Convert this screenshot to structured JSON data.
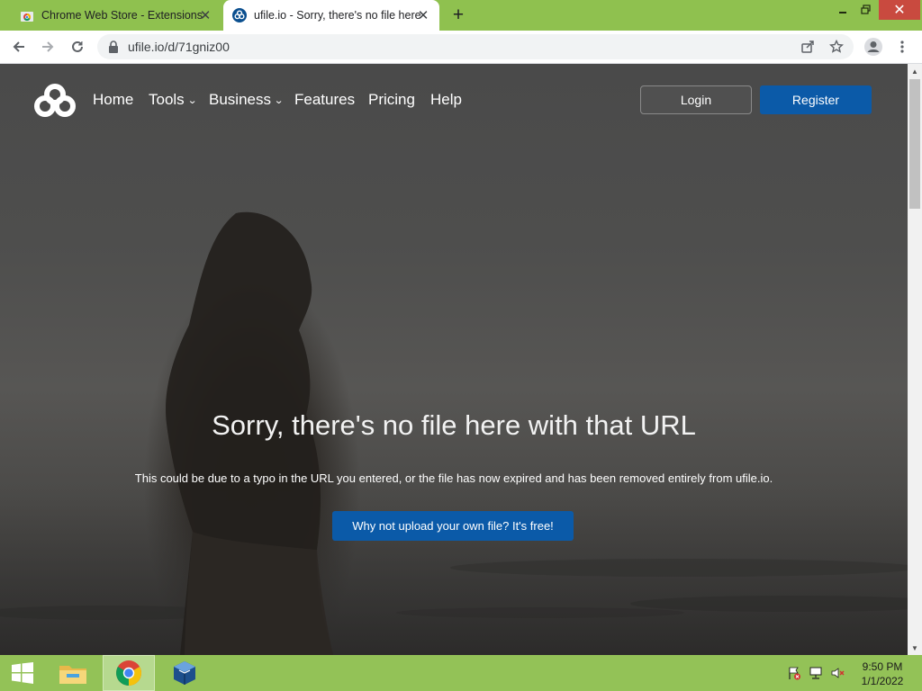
{
  "browser": {
    "tabs": [
      {
        "title": "Chrome Web Store - Extensions",
        "icon": "chrome-web-store-icon"
      },
      {
        "title": "ufile.io - Sorry, there's no file here",
        "icon": "ufile-icon",
        "active": true
      }
    ],
    "new_tab_label": "+",
    "url": "ufile.io/d/71gniz00"
  },
  "page": {
    "nav": {
      "items": [
        "Home",
        "Tools",
        "Business",
        "Features",
        "Pricing",
        "Help"
      ],
      "dropdowns": [
        "Tools",
        "Business"
      ],
      "login_label": "Login",
      "register_label": "Register"
    },
    "headline": "Sorry, there's no file here with that URL",
    "subtext": "This could be due to a typo in the URL you entered, or the file has now expired and has been removed entirely from ufile.io.",
    "cta_label": "Why not upload your own file? It's free!"
  },
  "taskbar": {
    "time": "9:50 PM",
    "date": "1/1/2022",
    "apps": [
      "start-icon",
      "file-explorer-icon",
      "chrome-icon",
      "virtualbox-icon"
    ]
  },
  "colors": {
    "accent_blue": "#0b5aa8",
    "chrome_frame": "#8fc14f",
    "taskbar": "#93c257"
  }
}
